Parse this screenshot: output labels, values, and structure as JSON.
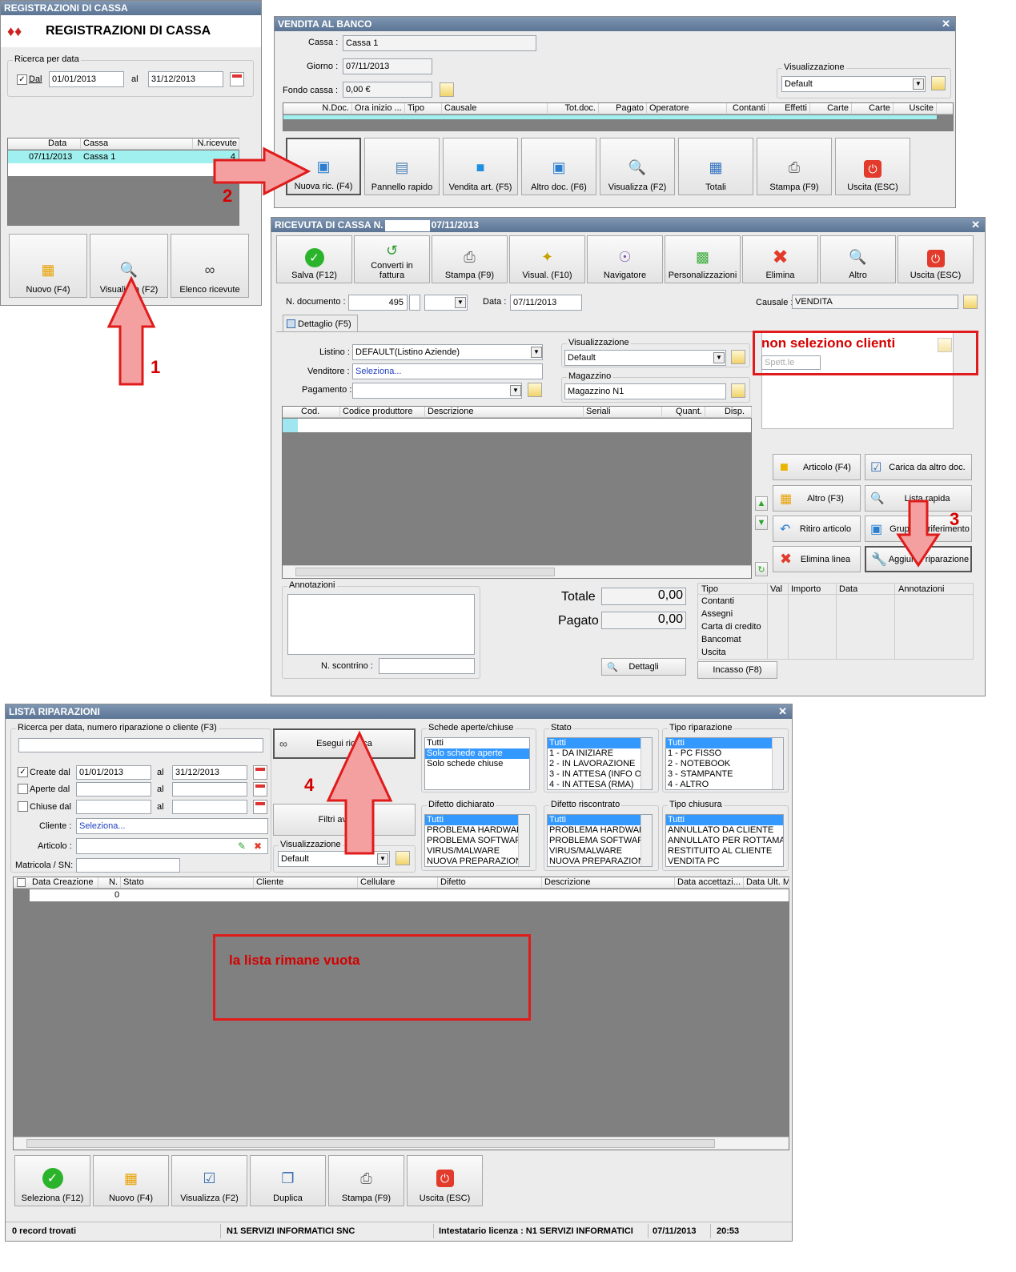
{
  "win1": {
    "title": "REGISTRAZIONI DI CASSA",
    "heading": "REGISTRAZIONI DI CASSA",
    "group_label": "Ricerca per data",
    "dal_label": "Dal",
    "dal_value": "01/01/2013",
    "al_label": "al",
    "al_value": "31/12/2013",
    "columns": [
      "Data",
      "Cassa",
      "N.ricevute"
    ],
    "row": {
      "data": "07/11/2013",
      "cassa": "Cassa 1",
      "nricevute": "4"
    },
    "buttons": [
      "Nuovo (F4)",
      "Visualizza (F2)",
      "Elenco ricevute"
    ]
  },
  "win2": {
    "title": "VENDITA AL BANCO",
    "cassa_label": "Cassa :",
    "cassa_value": "Cassa 1",
    "giorno_label": "Giorno :",
    "giorno_value": "07/11/2013",
    "fondo_label": "Fondo cassa :",
    "fondo_value": "0,00 €",
    "vis_label": "Visualizzazione",
    "vis_value": "Default",
    "columns": [
      "N.Doc.",
      "Ora inizio ...",
      "Tipo",
      "Causale",
      "Tot.doc.",
      "Pagato",
      "Operatore",
      "Contanti",
      "Effetti",
      "Carte",
      "Carte",
      "Uscite"
    ],
    "buttons": [
      "Nuova ric. (F4)",
      "Pannello rapido",
      "Vendita art. (F5)",
      "Altro doc. (F6)",
      "Visualizza (F2)",
      "Totali",
      "Stampa (F9)",
      "Uscita (ESC)"
    ]
  },
  "win3": {
    "title_prefix": "RICEVUTA DI CASSA N.",
    "title_date": "07/11/2013",
    "toolbar": [
      "Salva (F12)",
      "Converti in fattura",
      "Stampa (F9)",
      "Visual. (F10)",
      "Navigatore",
      "Personalizzazioni",
      "Elimina",
      "Altro",
      "Uscita (ESC)"
    ],
    "ndoc_label": "N. documento :",
    "ndoc_value": "495",
    "data_label": "Data :",
    "data_value": "07/11/2013",
    "causale_label": "Causale :",
    "causale_value": "VENDITA",
    "tab": "Dettaglio (F5)",
    "listino_label": "Listino :",
    "listino_value": "DEFAULT(Listino Aziende)",
    "venditore_label": "Venditore :",
    "venditore_value": "Seleziona...",
    "pagamento_label": "Pagamento :",
    "vis_label": "Visualizzazione",
    "vis_value": "Default",
    "mag_label": "Magazzino",
    "mag_value": "Magazzino N1",
    "cliente_placeholder": "Spett.le",
    "columns": [
      "Cod.",
      "Codice produttore",
      "Descrizione",
      "Seriali",
      "Quant.",
      "Disp."
    ],
    "side_buttons": [
      "Articolo (F4)",
      "Carica da altro doc.",
      "Altro (F3)",
      "Lista rapida",
      "Ritiro articolo",
      "Gruppi di riferimento",
      "Elimina linea",
      "Aggiungi riparazione"
    ],
    "annotazioni_label": "Annotazioni",
    "scontrino_label": "N. scontrino :",
    "totale_label": "Totale",
    "totale_value": "0,00",
    "pagato_label": "Pagato",
    "pagato_value": "0,00",
    "dettagli_button": "Dettagli",
    "pay_columns": [
      "Tipo",
      "Val",
      "Importo",
      "Data",
      "Annotazioni"
    ],
    "pay_rows": [
      "Contanti",
      "Assegni",
      "Carta di credito",
      "Bancomat",
      "Uscita"
    ],
    "incasso_button": "Incasso (F8)"
  },
  "win4": {
    "title": "LISTA RIPARAZIONI",
    "search_label": "Ricerca per data, numero riparazione o cliente (F3)",
    "search_button": "Esegui ricerca",
    "create_label": "Create dal",
    "create_from": "01/01/2013",
    "create_to": "31/12/2013",
    "aperte_label": "Aperte dal",
    "chiuse_label": "Chiuse dal",
    "al_label": "al",
    "cliente_label": "Cliente :",
    "cliente_value": "Seleziona...",
    "articolo_label": "Articolo :",
    "matricola_label": "Matricola / SN:",
    "filtri_button": "Filtri avanzati",
    "vis_label": "Visualizzazione",
    "vis_value": "Default",
    "schede_label": "Schede aperte/chiuse",
    "schede_items": [
      "Tutti",
      "Solo schede aperte",
      "Solo schede chiuse"
    ],
    "stato_label": "Stato",
    "stato_items": [
      "Tutti",
      "1 - DA INIZIARE",
      "2 - IN LAVORAZIONE",
      "3 - IN ATTESA (INFO O",
      "4 - IN ATTESA (RMA)"
    ],
    "tiporip_label": "Tipo riparazione",
    "tiporip_items": [
      "Tutti",
      "1 - PC FISSO",
      "2 - NOTEBOOK",
      "3 - STAMPANTE",
      "4 - ALTRO"
    ],
    "difdich_label": "Difetto dichiarato",
    "difdich_items": [
      "Tutti",
      "PROBLEMA HARDWARE",
      "PROBLEMA SOFTWARE",
      "VIRUS/MALWARE",
      "NUOVA PREPARAZIONE"
    ],
    "difris_label": "Difetto riscontrato",
    "difris_items": [
      "Tutti",
      "PROBLEMA HARDWARE",
      "PROBLEMA SOFTWARE",
      "VIRUS/MALWARE",
      "NUOVA PREPARAZIONE"
    ],
    "tipochius_label": "Tipo chiusura",
    "tipochius_items": [
      "Tutti",
      "ANNULLATO DA CLIENTE",
      "ANNULLATO PER ROTTAMAZIO",
      "RESTITUITO AL CLIENTE",
      "VENDITA PC"
    ],
    "columns": [
      "Data Creazione",
      "N.",
      "Stato",
      "Cliente",
      "Cellulare",
      "Difetto",
      "Descrizione",
      "Data accettazi...",
      "Data Ult. M"
    ],
    "row_n": "0",
    "buttons": [
      "Seleziona (F12)",
      "Nuovo (F4)",
      "Visualizza (F2)",
      "Duplica",
      "Stampa (F9)",
      "Uscita (ESC)"
    ],
    "status": [
      "0 record trovati",
      "N1 SERVIZI INFORMATICI SNC",
      "Intestatario licenza : N1 SERVIZI INFORMATICI",
      "07/11/2013",
      "20:53"
    ]
  },
  "annotations": {
    "step1": "1",
    "step2": "2",
    "step3": "3",
    "step4": "4",
    "note_clienti": "non seleziono clienti",
    "note_lista": "la lista rimane vuota"
  },
  "colors": {
    "accent_red": "#e01b1b",
    "titlebar": "#6a83a3",
    "selection": "#3399ff",
    "grid_bg": "#808080"
  }
}
